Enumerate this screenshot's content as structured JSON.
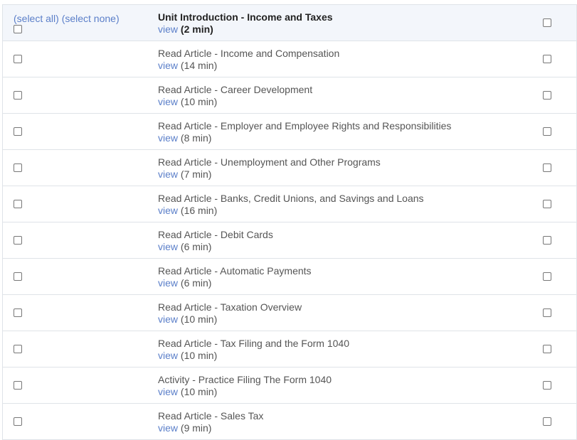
{
  "header": {
    "select_all": "(select all)",
    "select_none": "(select none)",
    "title": "Unit Introduction - Income and Taxes",
    "view_label": "view",
    "duration": "(2 min)"
  },
  "items": [
    {
      "title": "Read Article - Income and Compensation",
      "view_label": "view",
      "duration": "(14 min)"
    },
    {
      "title": "Read Article - Career Development",
      "view_label": "view",
      "duration": "(10 min)"
    },
    {
      "title": "Read Article - Employer and Employee Rights and Responsibilities",
      "view_label": "view",
      "duration": "(8 min)"
    },
    {
      "title": "Read Article - Unemployment and Other Programs",
      "view_label": "view",
      "duration": "(7 min)"
    },
    {
      "title": "Read Article - Banks, Credit Unions, and Savings and Loans",
      "view_label": "view",
      "duration": "(16 min)"
    },
    {
      "title": "Read Article - Debit Cards",
      "view_label": "view",
      "duration": "(6 min)"
    },
    {
      "title": "Read Article - Automatic Payments",
      "view_label": "view",
      "duration": "(6 min)"
    },
    {
      "title": "Read Article - Taxation Overview",
      "view_label": "view",
      "duration": "(10 min)"
    },
    {
      "title": "Read Article - Tax Filing and the Form 1040",
      "view_label": "view",
      "duration": "(10 min)"
    },
    {
      "title": "Activity - Practice Filing The Form 1040",
      "view_label": "view",
      "duration": "(10 min)"
    },
    {
      "title": "Read Article - Sales Tax",
      "view_label": "view",
      "duration": "(9 min)"
    }
  ],
  "colors": {
    "link": "#5b7fc9",
    "header_bg": "#f3f6fb",
    "border": "#dfe3e8",
    "text": "#555555"
  }
}
